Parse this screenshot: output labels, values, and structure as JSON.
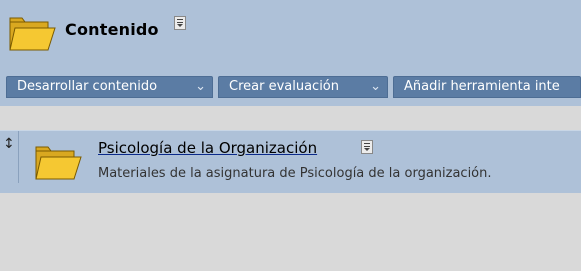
{
  "header": {
    "title": "Contenido",
    "folder_icon": "folder-icon",
    "menu_icon": "options-menu-icon"
  },
  "toolbar": {
    "buttons": [
      {
        "label": "Desarrollar contenido",
        "icon": "double-chevron-down-icon"
      },
      {
        "label": "Crear evaluación",
        "icon": "double-chevron-down-icon"
      },
      {
        "label": "Añadir herramienta inte"
      }
    ]
  },
  "content_item": {
    "drag_icon": "drag-handle-icon",
    "folder_icon": "folder-icon",
    "title": "Psicología de la Organización",
    "menu_icon": "options-menu-icon",
    "description": "Materiales de la asignatura de Psicología de la organización."
  },
  "colors": {
    "header_bg": "#aec1d8",
    "button_bg": "#5b7ca4",
    "page_bg": "#d9d9d9",
    "folder": "#f5c832"
  }
}
